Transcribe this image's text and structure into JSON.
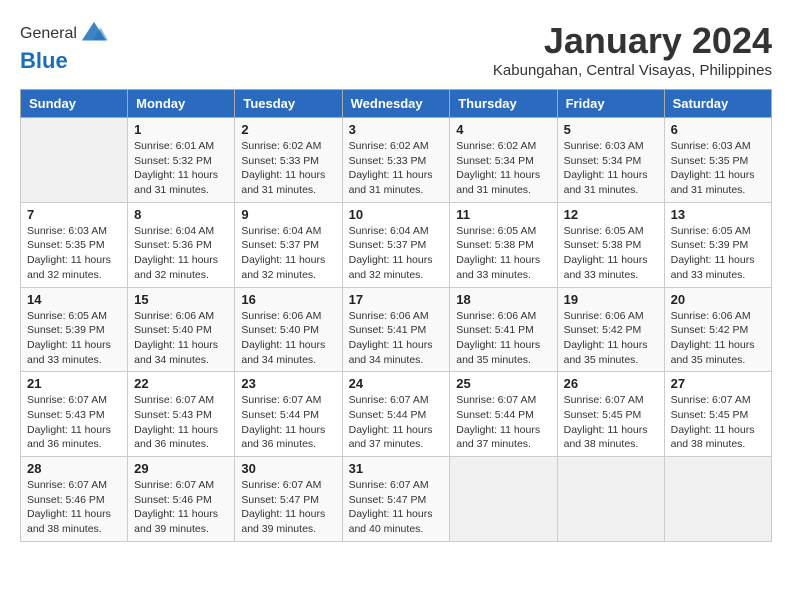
{
  "header": {
    "logo_general": "General",
    "logo_blue": "Blue",
    "month": "January 2024",
    "location": "Kabungahan, Central Visayas, Philippines"
  },
  "calendar": {
    "days_of_week": [
      "Sunday",
      "Monday",
      "Tuesday",
      "Wednesday",
      "Thursday",
      "Friday",
      "Saturday"
    ],
    "weeks": [
      [
        {
          "day": "",
          "info": ""
        },
        {
          "day": "1",
          "info": "Sunrise: 6:01 AM\nSunset: 5:32 PM\nDaylight: 11 hours and 31 minutes."
        },
        {
          "day": "2",
          "info": "Sunrise: 6:02 AM\nSunset: 5:33 PM\nDaylight: 11 hours and 31 minutes."
        },
        {
          "day": "3",
          "info": "Sunrise: 6:02 AM\nSunset: 5:33 PM\nDaylight: 11 hours and 31 minutes."
        },
        {
          "day": "4",
          "info": "Sunrise: 6:02 AM\nSunset: 5:34 PM\nDaylight: 11 hours and 31 minutes."
        },
        {
          "day": "5",
          "info": "Sunrise: 6:03 AM\nSunset: 5:34 PM\nDaylight: 11 hours and 31 minutes."
        },
        {
          "day": "6",
          "info": "Sunrise: 6:03 AM\nSunset: 5:35 PM\nDaylight: 11 hours and 31 minutes."
        }
      ],
      [
        {
          "day": "7",
          "info": "Sunrise: 6:03 AM\nSunset: 5:35 PM\nDaylight: 11 hours and 32 minutes."
        },
        {
          "day": "8",
          "info": "Sunrise: 6:04 AM\nSunset: 5:36 PM\nDaylight: 11 hours and 32 minutes."
        },
        {
          "day": "9",
          "info": "Sunrise: 6:04 AM\nSunset: 5:37 PM\nDaylight: 11 hours and 32 minutes."
        },
        {
          "day": "10",
          "info": "Sunrise: 6:04 AM\nSunset: 5:37 PM\nDaylight: 11 hours and 32 minutes."
        },
        {
          "day": "11",
          "info": "Sunrise: 6:05 AM\nSunset: 5:38 PM\nDaylight: 11 hours and 33 minutes."
        },
        {
          "day": "12",
          "info": "Sunrise: 6:05 AM\nSunset: 5:38 PM\nDaylight: 11 hours and 33 minutes."
        },
        {
          "day": "13",
          "info": "Sunrise: 6:05 AM\nSunset: 5:39 PM\nDaylight: 11 hours and 33 minutes."
        }
      ],
      [
        {
          "day": "14",
          "info": "Sunrise: 6:05 AM\nSunset: 5:39 PM\nDaylight: 11 hours and 33 minutes."
        },
        {
          "day": "15",
          "info": "Sunrise: 6:06 AM\nSunset: 5:40 PM\nDaylight: 11 hours and 34 minutes."
        },
        {
          "day": "16",
          "info": "Sunrise: 6:06 AM\nSunset: 5:40 PM\nDaylight: 11 hours and 34 minutes."
        },
        {
          "day": "17",
          "info": "Sunrise: 6:06 AM\nSunset: 5:41 PM\nDaylight: 11 hours and 34 minutes."
        },
        {
          "day": "18",
          "info": "Sunrise: 6:06 AM\nSunset: 5:41 PM\nDaylight: 11 hours and 35 minutes."
        },
        {
          "day": "19",
          "info": "Sunrise: 6:06 AM\nSunset: 5:42 PM\nDaylight: 11 hours and 35 minutes."
        },
        {
          "day": "20",
          "info": "Sunrise: 6:06 AM\nSunset: 5:42 PM\nDaylight: 11 hours and 35 minutes."
        }
      ],
      [
        {
          "day": "21",
          "info": "Sunrise: 6:07 AM\nSunset: 5:43 PM\nDaylight: 11 hours and 36 minutes."
        },
        {
          "day": "22",
          "info": "Sunrise: 6:07 AM\nSunset: 5:43 PM\nDaylight: 11 hours and 36 minutes."
        },
        {
          "day": "23",
          "info": "Sunrise: 6:07 AM\nSunset: 5:44 PM\nDaylight: 11 hours and 36 minutes."
        },
        {
          "day": "24",
          "info": "Sunrise: 6:07 AM\nSunset: 5:44 PM\nDaylight: 11 hours and 37 minutes."
        },
        {
          "day": "25",
          "info": "Sunrise: 6:07 AM\nSunset: 5:44 PM\nDaylight: 11 hours and 37 minutes."
        },
        {
          "day": "26",
          "info": "Sunrise: 6:07 AM\nSunset: 5:45 PM\nDaylight: 11 hours and 38 minutes."
        },
        {
          "day": "27",
          "info": "Sunrise: 6:07 AM\nSunset: 5:45 PM\nDaylight: 11 hours and 38 minutes."
        }
      ],
      [
        {
          "day": "28",
          "info": "Sunrise: 6:07 AM\nSunset: 5:46 PM\nDaylight: 11 hours and 38 minutes."
        },
        {
          "day": "29",
          "info": "Sunrise: 6:07 AM\nSunset: 5:46 PM\nDaylight: 11 hours and 39 minutes."
        },
        {
          "day": "30",
          "info": "Sunrise: 6:07 AM\nSunset: 5:47 PM\nDaylight: 11 hours and 39 minutes."
        },
        {
          "day": "31",
          "info": "Sunrise: 6:07 AM\nSunset: 5:47 PM\nDaylight: 11 hours and 40 minutes."
        },
        {
          "day": "",
          "info": ""
        },
        {
          "day": "",
          "info": ""
        },
        {
          "day": "",
          "info": ""
        }
      ]
    ]
  }
}
